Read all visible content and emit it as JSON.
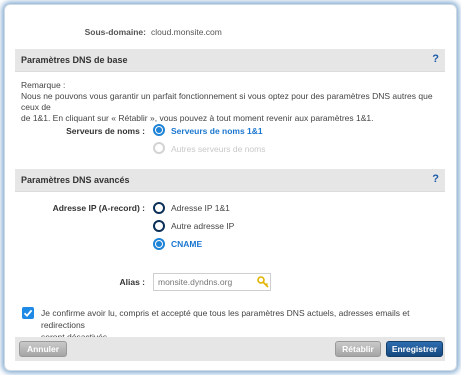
{
  "subdomain": {
    "label": "Sous-domaine:",
    "value": "cloud.monsite.com"
  },
  "basic": {
    "title": "Paramètres DNS de base",
    "help": "?",
    "remark_title": "Remarque :",
    "remark_line1": "Nous ne pouvons vous garantir un parfait fonctionnement si vous optez pour des paramètres DNS autres que ceux de",
    "remark_line2": "de 1&1. En cliquant sur « Rétablir », vous pouvez à tout moment revenir aux paramètres 1&1.",
    "nameservers_label": "Serveurs de noms :",
    "nameservers_options": [
      {
        "label": "Serveurs de noms 1&1",
        "state": "selected"
      },
      {
        "label": "Autres serveurs de noms",
        "state": "disabled"
      }
    ]
  },
  "advanced": {
    "title": "Paramètres DNS avancés",
    "help": "?",
    "ip_label": "Adresse IP (A-record) :",
    "ip_options": [
      {
        "label": "Adresse IP 1&1",
        "state": "unselected"
      },
      {
        "label": "Autre adresse IP",
        "state": "unselected"
      },
      {
        "label": "CNAME",
        "state": "selected"
      }
    ],
    "alias_label": "Alias :",
    "alias_value": "monsite.dyndns.org"
  },
  "confirm": {
    "checked": true,
    "line1": "Je confirme avoir lu, compris et accepté que tous les paramètres DNS actuels, adresses emails et redirections",
    "line2": "seront désactivés."
  },
  "footer": {
    "cancel": "Annuler",
    "restore": "Rétablir",
    "save": "Enregistrer"
  },
  "colors": {
    "accent": "#1f83d6",
    "save_button": "#1c5594",
    "panel_header": "#e6e6e6"
  },
  "icons": {
    "alias": "key-icon",
    "checkbox": "checkmark-icon"
  }
}
